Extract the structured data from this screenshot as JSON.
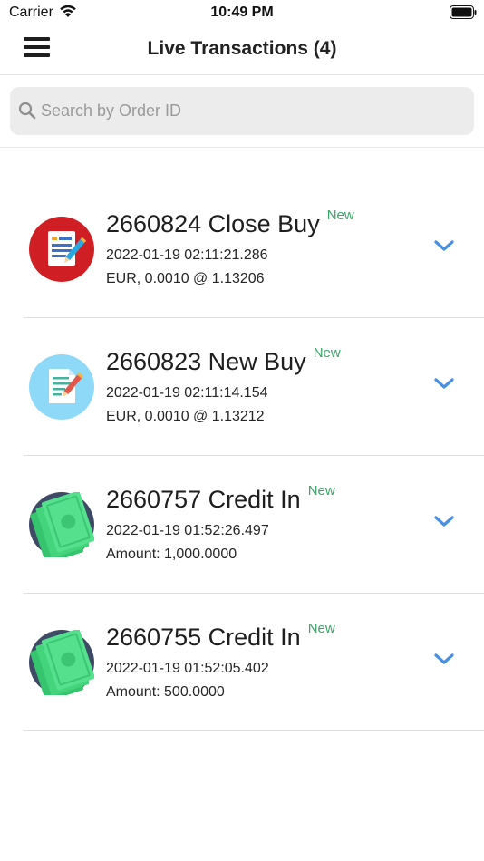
{
  "status_bar": {
    "carrier": "Carrier",
    "time": "10:49 PM"
  },
  "nav": {
    "title": "Live Transactions (4)"
  },
  "search": {
    "placeholder": "Search by Order ID",
    "value": ""
  },
  "colors": {
    "badge": "#3da46a",
    "chevron": "#4a90e2"
  },
  "transactions": [
    {
      "id": "2660824",
      "type": "Close Buy",
      "badge": "New",
      "timestamp": "2022-01-19 02:11:21.286",
      "detail": "EUR, 0.0010 @ 1.13206",
      "icon": "close-buy-document-icon"
    },
    {
      "id": "2660823",
      "type": "New Buy",
      "badge": "New",
      "timestamp": "2022-01-19 02:11:14.154",
      "detail": "EUR, 0.0010 @ 1.13212",
      "icon": "new-buy-document-icon"
    },
    {
      "id": "2660757",
      "type": "Credit In",
      "badge": "New",
      "timestamp": "2022-01-19 01:52:26.497",
      "detail": "Amount: 1,000.0000",
      "icon": "money-icon"
    },
    {
      "id": "2660755",
      "type": "Credit In",
      "badge": "New",
      "timestamp": "2022-01-19 01:52:05.402",
      "detail": "Amount: 500.0000",
      "icon": "money-icon"
    }
  ]
}
